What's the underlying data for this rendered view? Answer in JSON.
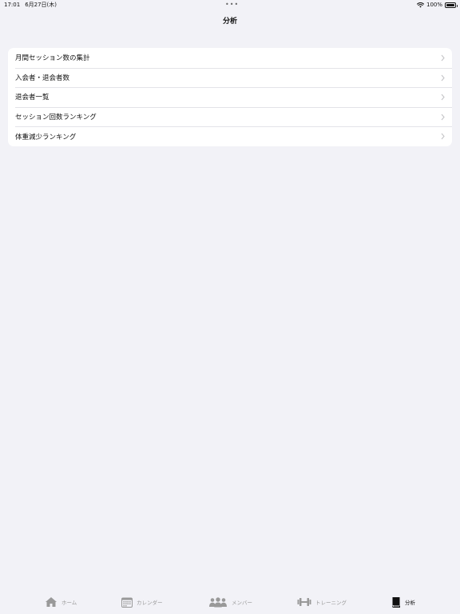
{
  "status_bar": {
    "time": "17:01",
    "date": "6月27日(木)",
    "dots": "•••",
    "battery": "100%"
  },
  "nav": {
    "title": "分析"
  },
  "menu": {
    "items": [
      {
        "label": "月間セッション数の集計"
      },
      {
        "label": "入会者・退会者数"
      },
      {
        "label": "退会者一覧"
      },
      {
        "label": "セッション回数ランキング"
      },
      {
        "label": "体重減少ランキング"
      }
    ]
  },
  "tabs": [
    {
      "label": "ホーム",
      "icon": "home-icon"
    },
    {
      "label": "カレンダー",
      "icon": "calendar-icon"
    },
    {
      "label": "メンバー",
      "icon": "members-icon"
    },
    {
      "label": "トレーニング",
      "icon": "dumbbell-icon"
    },
    {
      "label": "分析",
      "icon": "book-icon",
      "active": true
    }
  ],
  "colors": {
    "background": "#f2f2f7",
    "active_tab": "#111111",
    "inactive_tab": "#999999"
  }
}
